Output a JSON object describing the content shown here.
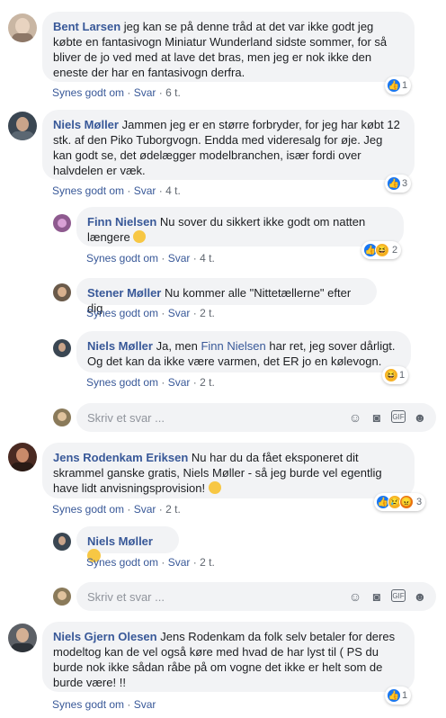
{
  "comments": [
    {
      "name": "Bent Larsen",
      "text": "jeg kan se på denne tråd at det var ikke godt jeg købte en fantasivogn Miniatur Wunderland sidste sommer, for så bliver de jo ved med at lave det bras, men jeg er nok ikke den eneste der har en fantasivogn derfra.",
      "like": "Synes godt om",
      "reply": "Svar",
      "time": "6 t.",
      "reactions": "1"
    },
    {
      "name": "Niels Møller",
      "text": "Jammen jeg er en større forbryder, for jeg har købt 12 stk. af den Piko Tuborgvogn. Endda med videresalg for øje. Jeg kan godt se, det ødelægger modelbranchen, især fordi over halvdelen er væk.",
      "like": "Synes godt om",
      "reply": "Svar",
      "time": "4 t.",
      "reactions": "3"
    },
    {
      "name": "Jens Rodenkam Eriksen",
      "text": "Nu har du da fået eksponeret dit skrammel ganske gratis, Niels Møller - så jeg burde vel egentlig have lidt anvisningsprovision!",
      "like": "Synes godt om",
      "reply": "Svar",
      "time": "2 t.",
      "reactions": "3"
    },
    {
      "name": "Niels Gjern Olesen",
      "text": "Jens Rodenkam da folk selv betaler for deres modeltog kan de vel også køre med hvad de har lyst til ( PS du burde nok ikke sådan råbe på om vogne det ikke er helt som de burde være! !!",
      "like": "Synes godt om",
      "reply": "Svar",
      "reactions": "1"
    }
  ],
  "replies": [
    {
      "name": "Finn Nielsen",
      "text": "Nu sover du sikkert ikke godt om natten længere",
      "like": "Synes godt om",
      "reply": "Svar",
      "time": "4 t.",
      "reactions": "2"
    },
    {
      "name": "Stener Møller",
      "text": "Nu kommer alle \"Nittetællerne\" efter dig",
      "like": "Synes godt om",
      "reply": "Svar",
      "time": "2 t."
    },
    {
      "name": "Niels Møller",
      "text_pre": "Ja, men",
      "mention": "Finn Nielsen",
      "text_post": "har ret, jeg sover dårligt. Og det kan da ikke være varmen, det ER jo en kølevogn.",
      "like": "Synes godt om",
      "reply": "Svar",
      "time": "2 t.",
      "reactions": "1"
    },
    {
      "name": "Niels Møller",
      "like": "Synes godt om",
      "reply": "Svar",
      "time": "2 t."
    }
  ],
  "reply_box": {
    "placeholder": "Skriv et svar ..."
  },
  "separator": "·",
  "icons": [
    "like-icon",
    "haha-icon",
    "sad-icon",
    "angry-icon",
    "smiley-icon",
    "camera-icon",
    "gif-icon",
    "sticker-icon"
  ],
  "colors": {
    "link": "#385898",
    "bubble": "#f2f3f5",
    "like": "#1877f2",
    "meta": "#606770"
  }
}
